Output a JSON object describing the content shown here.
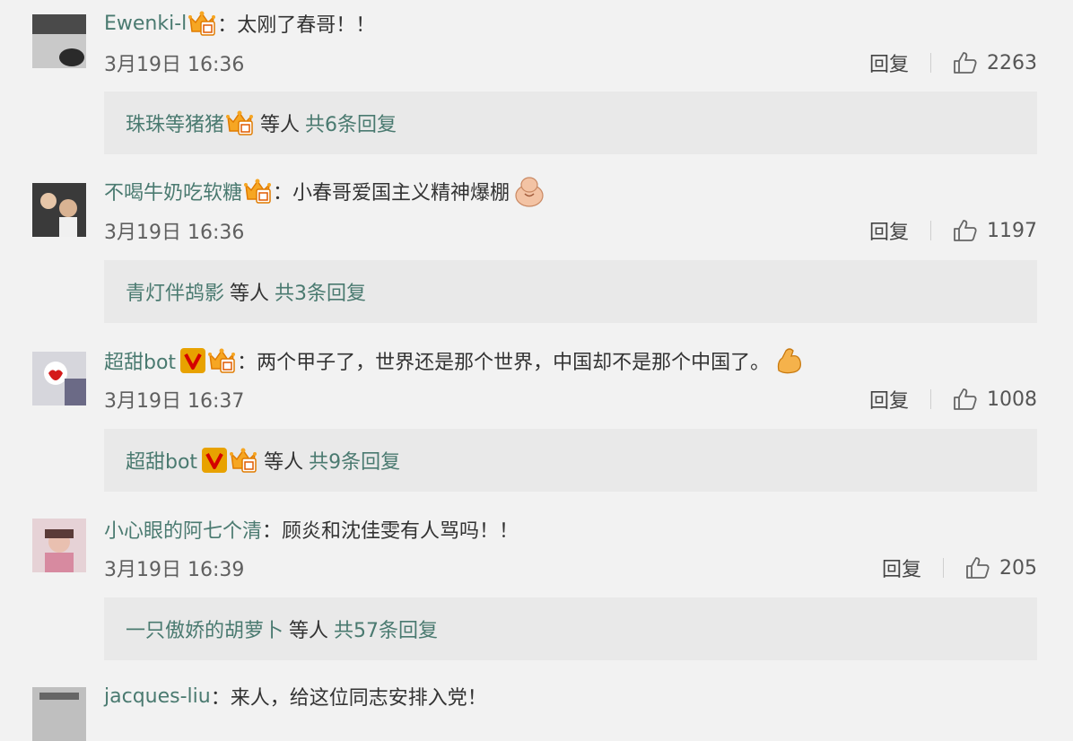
{
  "comments": [
    {
      "username": "Ewenki-l",
      "text": "太刚了春哥！！",
      "time": "3月19日 16:36",
      "reply_label": "回复",
      "likes": "2263",
      "replies": {
        "user": "珠珠等猪猪",
        "etc": "等人",
        "count": "共6条回复"
      }
    },
    {
      "username": "不喝牛奶吃软糖",
      "text": "小春哥爱国主义精神爆棚",
      "time": "3月19日 16:36",
      "reply_label": "回复",
      "likes": "1197",
      "replies": {
        "user": "青灯伴鸪影",
        "etc": "等人",
        "count": "共3条回复"
      }
    },
    {
      "username": "超甜bot",
      "text": "两个甲子了，世界还是那个世界，中国却不是那个中国了。",
      "time": "3月19日 16:37",
      "reply_label": "回复",
      "likes": "1008",
      "replies": {
        "user": "超甜bot",
        "etc": "等人",
        "count": "共9条回复"
      }
    },
    {
      "username": "小心眼的阿七个清",
      "text": "顾炎和沈佳雯有人骂吗！！",
      "time": "3月19日 16:39",
      "reply_label": "回复",
      "likes": "205",
      "replies": {
        "user": "一只傲娇的胡萝卜",
        "etc": "等人",
        "count": "共57条回复"
      }
    },
    {
      "username": "jacques-liu",
      "text": "来人，给这位同志安排入党！"
    }
  ],
  "colors": {
    "username": "#4a7a70",
    "background": "#f2f2f2",
    "reply_box": "#e9e9e9"
  },
  "icons": {
    "like": "thumbs-up-icon",
    "member_badge": "crown-member-icon",
    "verified": "verified-v-icon"
  }
}
